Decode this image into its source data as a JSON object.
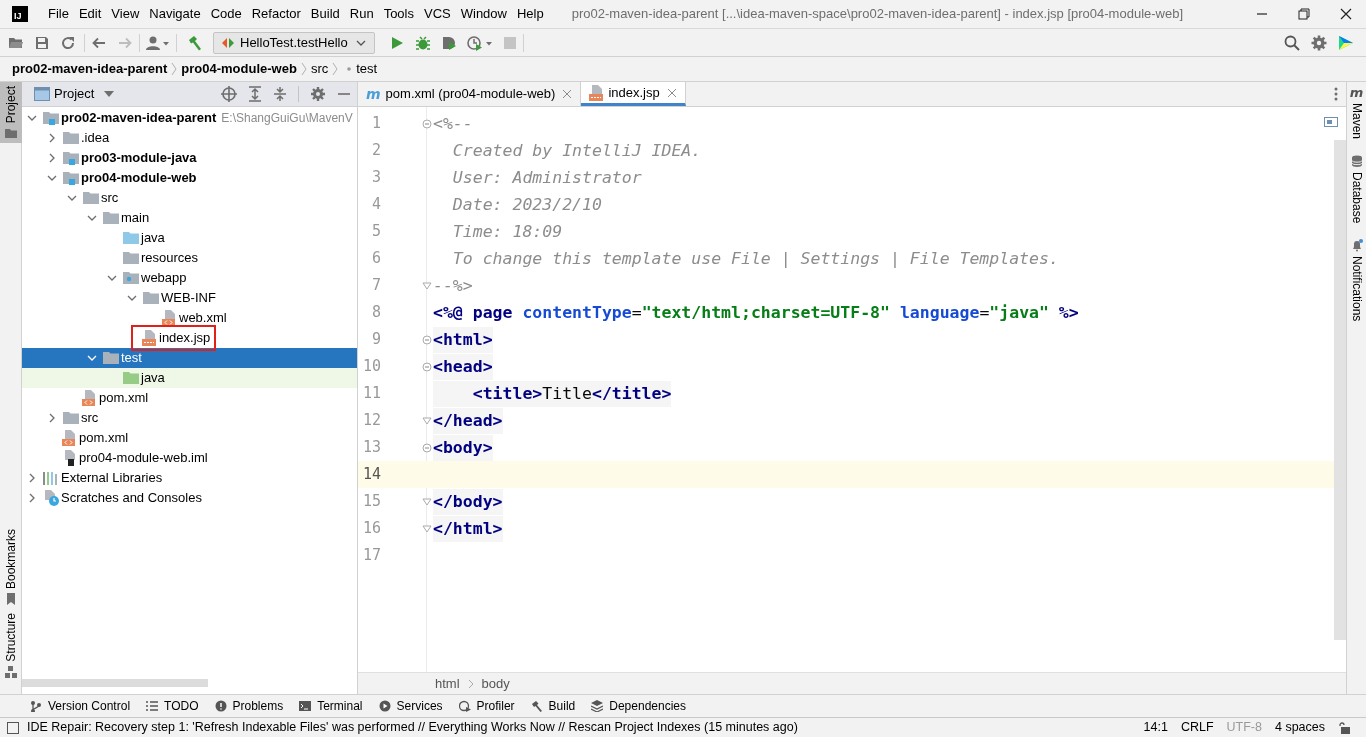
{
  "window": {
    "app_logo": "IJ",
    "title": "pro02-maven-idea-parent [...\\idea-maven-space\\pro02-maven-idea-parent] - index.jsp [pro04-module-web]"
  },
  "menu": [
    "File",
    "Edit",
    "View",
    "Navigate",
    "Code",
    "Refactor",
    "Build",
    "Run",
    "Tools",
    "VCS",
    "Window",
    "Help"
  ],
  "toolbar": {
    "run_configuration": "HelloTest.testHello",
    "forward_disabled": true,
    "stop_disabled": true
  },
  "navigation_bar": [
    {
      "label": "pro02-maven-idea-parent",
      "bold": true
    },
    {
      "label": "pro04-module-web",
      "bold": true
    },
    {
      "label": "src",
      "bold": false
    },
    {
      "label": "test",
      "bold": false
    }
  ],
  "left_strip": [
    {
      "label": "Project",
      "selected": true
    },
    {
      "label": "Bookmarks",
      "selected": false
    },
    {
      "label": "Structure",
      "selected": false
    }
  ],
  "project_panel": {
    "title": "Project",
    "tree": [
      {
        "label": "pro02-maven-idea-parent",
        "kind": "module",
        "bold": true,
        "hint": "E:\\ShangGuiGu\\MavenV",
        "expanded": true,
        "selected": false,
        "children": [
          {
            "label": ".idea",
            "kind": "folder",
            "bold": false,
            "expanded": false,
            "selected": false
          },
          {
            "label": "pro03-module-java",
            "kind": "module",
            "bold": true,
            "expanded": false,
            "selected": false
          },
          {
            "label": "pro04-module-web",
            "kind": "module",
            "bold": true,
            "expanded": true,
            "selected": false,
            "children": [
              {
                "label": "src",
                "kind": "folder",
                "bold": false,
                "expanded": true,
                "selected": false,
                "children": [
                  {
                    "label": "main",
                    "kind": "folder",
                    "bold": false,
                    "expanded": true,
                    "selected": false,
                    "children": [
                      {
                        "label": "java",
                        "kind": "source_folder",
                        "bold": false,
                        "selected": false
                      },
                      {
                        "label": "resources",
                        "kind": "folder",
                        "bold": false,
                        "selected": false
                      },
                      {
                        "label": "webapp",
                        "kind": "web_folder",
                        "bold": false,
                        "expanded": true,
                        "selected": false,
                        "children": [
                          {
                            "label": "WEB-INF",
                            "kind": "folder",
                            "bold": false,
                            "expanded": true,
                            "selected": false,
                            "children": [
                              {
                                "label": "web.xml",
                                "kind": "xml",
                                "bold": false,
                                "selected": false
                              }
                            ]
                          },
                          {
                            "label": "index.jsp",
                            "kind": "jsp",
                            "bold": false,
                            "selected": false,
                            "outlined": true
                          }
                        ]
                      }
                    ]
                  },
                  {
                    "label": "test",
                    "kind": "folder",
                    "bold": false,
                    "expanded": true,
                    "selected": true,
                    "children": [
                      {
                        "label": "java",
                        "kind": "test_folder",
                        "bold": false,
                        "selected": false,
                        "tinted": true
                      }
                    ]
                  }
                ]
              },
              {
                "label": "pom.xml",
                "kind": "xml",
                "bold": false,
                "selected": false
              }
            ]
          },
          {
            "label": "src",
            "kind": "folder",
            "bold": false,
            "expanded": false,
            "selected": false
          },
          {
            "label": "pom.xml",
            "kind": "xml",
            "bold": false,
            "selected": false
          },
          {
            "label": "pro04-module-web.iml",
            "kind": "iml",
            "bold": false,
            "selected": false
          }
        ]
      },
      {
        "label": "External Libraries",
        "kind": "libraries",
        "bold": false,
        "expanded": false,
        "selected": false
      },
      {
        "label": "Scratches and Consoles",
        "kind": "scratches",
        "bold": false,
        "expanded": false,
        "selected": false
      }
    ]
  },
  "editor": {
    "tabs": [
      {
        "label": "pom.xml (pro04-module-web)",
        "kind": "maven",
        "glyph": "m",
        "selected": false
      },
      {
        "label": "index.jsp",
        "kind": "jsp",
        "selected": true
      }
    ],
    "lines": [
      {
        "number": "1",
        "current": false,
        "fold_start": true,
        "segments": [
          {
            "kind": "comment",
            "text": "<%--"
          }
        ]
      },
      {
        "number": "2",
        "current": false,
        "segments": [
          {
            "kind": "comment",
            "text": "  Created by IntelliJ IDEA."
          }
        ]
      },
      {
        "number": "3",
        "current": false,
        "segments": [
          {
            "kind": "comment",
            "text": "  User: Administrator"
          }
        ]
      },
      {
        "number": "4",
        "current": false,
        "segments": [
          {
            "kind": "comment",
            "text": "  Date: 2023/2/10"
          }
        ]
      },
      {
        "number": "5",
        "current": false,
        "segments": [
          {
            "kind": "comment",
            "text": "  Time: 18:09"
          }
        ]
      },
      {
        "number": "6",
        "current": false,
        "segments": [
          {
            "kind": "comment",
            "text": "  To change this template use File | Settings | File Templates."
          }
        ]
      },
      {
        "number": "7",
        "current": false,
        "fold_end": true,
        "segments": [
          {
            "kind": "comment",
            "text": "--%>"
          }
        ]
      },
      {
        "number": "8",
        "current": false,
        "segments": [
          {
            "kind": "directive",
            "text": "<%@ page "
          },
          {
            "kind": "attr",
            "text": "contentType"
          },
          {
            "kind": "plain",
            "text": "="
          },
          {
            "kind": "string",
            "text": "\"text/html;charset=UTF-8\""
          },
          {
            "kind": "attr",
            "text": " language"
          },
          {
            "kind": "plain",
            "text": "="
          },
          {
            "kind": "string",
            "text": "\"java\""
          },
          {
            "kind": "directive",
            "text": " %>"
          }
        ]
      },
      {
        "number": "9",
        "current": false,
        "fold_start": true,
        "segments": [
          {
            "kind": "tag",
            "text": "<html>"
          }
        ]
      },
      {
        "number": "10",
        "current": false,
        "fold_start": true,
        "segments": [
          {
            "kind": "tag",
            "text": "<head>"
          }
        ]
      },
      {
        "number": "11",
        "current": false,
        "segments": [
          {
            "kind": "tag",
            "text": "    <title>"
          },
          {
            "kind": "plain",
            "text": "Title"
          },
          {
            "kind": "tag",
            "text": "</title>"
          }
        ]
      },
      {
        "number": "12",
        "current": false,
        "fold_end": true,
        "segments": [
          {
            "kind": "tag",
            "text": "</head>"
          }
        ]
      },
      {
        "number": "13",
        "current": false,
        "fold_start": true,
        "segments": [
          {
            "kind": "tag",
            "text": "<body>"
          }
        ]
      },
      {
        "number": "14",
        "current": true
      },
      {
        "number": "15",
        "current": false,
        "fold_end": true,
        "segments": [
          {
            "kind": "tag",
            "text": "</body>"
          }
        ]
      },
      {
        "number": "16",
        "current": false,
        "fold_end": true,
        "segments": [
          {
            "kind": "tag",
            "text": "</html>"
          }
        ]
      },
      {
        "number": "17",
        "current": false
      }
    ],
    "breadcrumbs": [
      "html",
      "body"
    ]
  },
  "right_strip": [
    {
      "label": "Maven",
      "glyph": "m",
      "kind": "maven"
    },
    {
      "label": "Database",
      "kind": "database"
    },
    {
      "label": "Notifications",
      "kind": "notifications"
    }
  ],
  "tool_windows": [
    "Version Control",
    "TODO",
    "Problems",
    "Terminal",
    "Services",
    "Profiler",
    "Build",
    "Dependencies"
  ],
  "status_bar": {
    "message": "IDE Repair: Recovery step 1: 'Refresh Indexable Files' was performed // Everything Works Now // Rescan Project Indexes (15 minutes ago)",
    "items": [
      {
        "text": "14:1",
        "disabled": false
      },
      {
        "text": "CRLF",
        "disabled": false
      },
      {
        "text": "UTF-8",
        "disabled": true
      },
      {
        "text": "4 spaces",
        "disabled": false
      }
    ]
  }
}
